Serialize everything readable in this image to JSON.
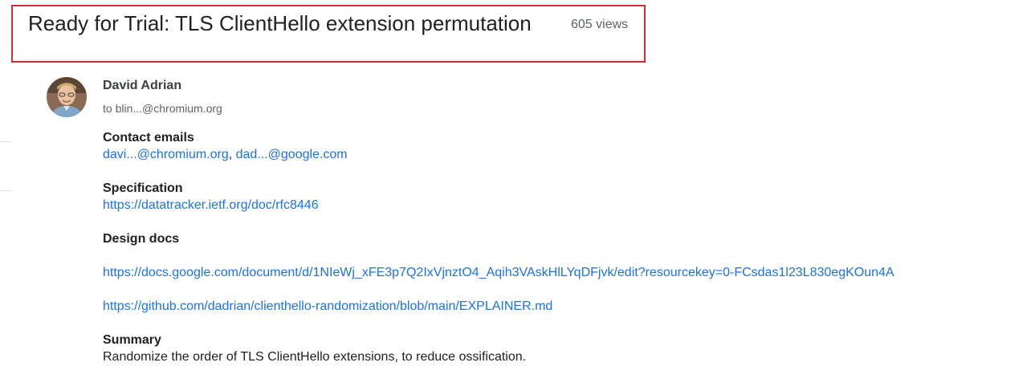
{
  "thread": {
    "title": "Ready for Trial: TLS ClientHello extension permutation",
    "views": "605 views"
  },
  "message": {
    "sender": "David Adrian",
    "recipient_line": "to blin...@chromium.org",
    "contact_emails": {
      "heading": "Contact emails",
      "email_1": "davi...@chromium.org",
      "separator": ", ",
      "email_2": "dad...@google.com"
    },
    "specification": {
      "heading": "Specification",
      "link": "https://datatracker.ietf.org/doc/rfc8446"
    },
    "design_docs": {
      "heading": "Design docs",
      "link_1": "https://docs.google.com/document/d/1NIeWj_xFE3p7Q2IxVjnztO4_Aqih3VAskHlLYqDFjvk/edit?resourcekey=0-FCsdas1l23L830egKOun4A",
      "link_2": "https://github.com/dadrian/clienthello-randomization/blob/main/EXPLAINER.md"
    },
    "summary": {
      "heading": "Summary",
      "text": "Randomize the order of TLS ClientHello extensions, to reduce ossification."
    }
  },
  "colors": {
    "highlight_border": "#d32f2f",
    "link": "#1a73e8",
    "secondary_text": "#5f6368"
  },
  "icons": {
    "avatar": "avatar"
  }
}
